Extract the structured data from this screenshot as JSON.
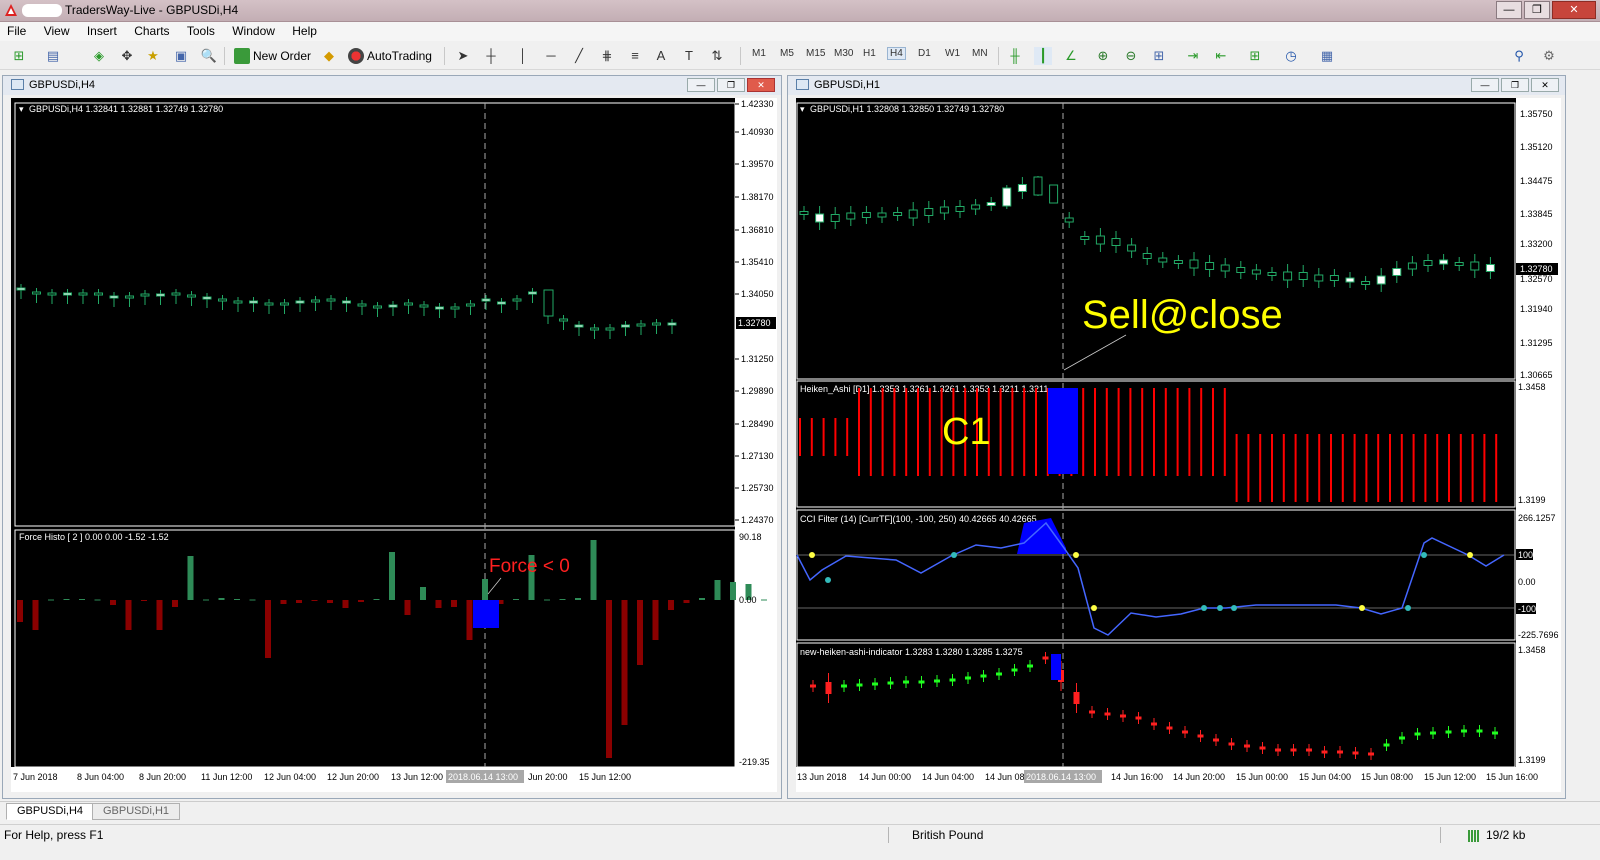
{
  "window": {
    "title": "TradersWay-Live - GBPUSDi,H4",
    "minimize": "—",
    "maximize": "❐",
    "close": "✕"
  },
  "menu": [
    "File",
    "View",
    "Insert",
    "Charts",
    "Tools",
    "Window",
    "Help"
  ],
  "toolbar": {
    "new_order": "New Order",
    "autotrading": "AutoTrading",
    "timeframes": [
      "M1",
      "M5",
      "M15",
      "M30",
      "H1",
      "H4",
      "D1",
      "W1",
      "MN"
    ],
    "selected_timeframe": "H4"
  },
  "left_chart": {
    "window_title": "GBPUSDi,H4",
    "symbol_info": "GBPUSDi,H4  1.32841 1.32881 1.32749 1.32780",
    "price_axis": [
      "1.42330",
      "1.40930",
      "1.39570",
      "1.38170",
      "1.36810",
      "1.35410",
      "1.34050",
      "1.32780",
      "1.31250",
      "1.29890",
      "1.28490",
      "1.27130",
      "1.25730",
      "1.24370"
    ],
    "current_price": "1.32780",
    "indicator_title": "Force Histo [ 2 ] 0.00 0.00 -1.52 -1.52",
    "indicator_axis": [
      "90.18",
      "0.00",
      "-219.35"
    ],
    "annotation": "Force < 0",
    "time_axis": [
      "7 Jun 2018",
      "8 Jun 04:00",
      "8 Jun 20:00",
      "11 Jun 12:00",
      "12 Jun 04:00",
      "12 Jun 20:00",
      "13 Jun 12:00",
      "2018.06.14 13:00",
      "Jun 20:00",
      "15 Jun 12:00"
    ]
  },
  "right_chart": {
    "window_title": "GBPUSDi,H1",
    "symbol_info": "GBPUSDi,H1  1.32808 1.32850 1.32749 1.32780",
    "price_axis": [
      "1.35750",
      "1.35120",
      "1.34475",
      "1.33845",
      "1.33200",
      "1.32570",
      "1.31940",
      "1.31295",
      "1.30665"
    ],
    "current_price": "1.32780",
    "annotation": "Sell@close",
    "heiken_title": "Heiken_Ashi [D1] 1.3353 1.3261 1.3261 1.3353 1.3211 1.3211",
    "heiken_axis": [
      "1.3458",
      "1.3199"
    ],
    "heiken_annotation": "C1",
    "cci_title": "CCI Filter (14) [CurrTF](100, -100, 250) 40.42665 40.42665",
    "cci_axis": [
      "266.1257",
      "100",
      "0.00",
      "-100",
      "-225.7696"
    ],
    "nha_title": "new-heiken-ashi-indicator 1.3283 1.3280 1.3285 1.3275",
    "nha_axis": [
      "1.3458",
      "1.3199"
    ],
    "time_axis": [
      "13 Jun 2018",
      "14 Jun 00:00",
      "14 Jun 04:00",
      "14 Jun 08",
      "2018.06.14 13:00",
      "14 Jun 16:00",
      "14 Jun 20:00",
      "15 Jun 00:00",
      "15 Jun 04:00",
      "15 Jun 08:00",
      "15 Jun 12:00",
      "15 Jun 16:00"
    ]
  },
  "tabs": [
    "GBPUSDi,H4",
    "GBPUSDi,H1"
  ],
  "active_tab": "GBPUSDi,H4",
  "status": {
    "help": "For Help, press F1",
    "symbol_name": "British Pound",
    "traffic": "19/2 kb"
  },
  "colors": {
    "chart_bg": "#000000",
    "bull": "#ffffff",
    "bear_line": "#22aa66",
    "force_up": "#2e8b57",
    "force_down": "#8b0000",
    "ha_bar": "#ff0000",
    "highlight": "#0000ff",
    "annotation": "#ffff00",
    "cci_line": "#4466ff"
  }
}
